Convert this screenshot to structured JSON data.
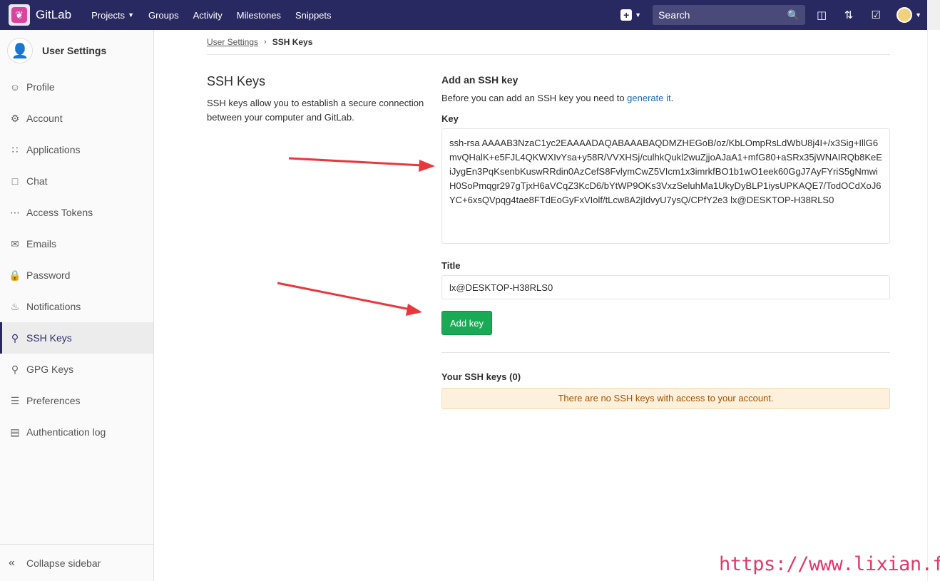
{
  "topbar": {
    "brand": "GitLab",
    "nav": [
      "Projects",
      "Groups",
      "Activity",
      "Milestones",
      "Snippets"
    ],
    "search_placeholder": "Search"
  },
  "sidebar": {
    "title": "User Settings",
    "items": [
      {
        "label": "Profile",
        "icon": "profile-icon"
      },
      {
        "label": "Account",
        "icon": "account-icon"
      },
      {
        "label": "Applications",
        "icon": "applications-icon"
      },
      {
        "label": "Chat",
        "icon": "chat-icon"
      },
      {
        "label": "Access Tokens",
        "icon": "access-tokens-icon"
      },
      {
        "label": "Emails",
        "icon": "emails-icon"
      },
      {
        "label": "Password",
        "icon": "lock-icon"
      },
      {
        "label": "Notifications",
        "icon": "bell-icon"
      },
      {
        "label": "SSH Keys",
        "icon": "key-icon"
      },
      {
        "label": "GPG Keys",
        "icon": "key-icon"
      },
      {
        "label": "Preferences",
        "icon": "sliders-icon"
      },
      {
        "label": "Authentication log",
        "icon": "log-icon"
      }
    ],
    "active_item": "SSH Keys",
    "collapse_label": "Collapse sidebar"
  },
  "breadcrumb": {
    "parent": "User Settings",
    "current": "SSH Keys"
  },
  "info": {
    "title": "SSH Keys",
    "description": "SSH keys allow you to establish a secure connection between your computer and GitLab."
  },
  "form": {
    "section_title": "Add an SSH key",
    "intro_text": "Before you can add an SSH key you need to ",
    "intro_link": "generate it",
    "intro_end": ".",
    "key_label": "Key",
    "key_value": "ssh-rsa AAAAB3NzaC1yc2EAAAADAQABAAABAQDMZHEGoB/oz/KbLOmpRsLdWbU8j4I+/x3Sig+IllG6mvQHalK+e5FJL4QKWXIvYsa+y58R/VVXHSj/culhkQukl2wuZjjoAJaA1+mfG80+aSRx35jWNAIRQb8KeEiJygEn3PqKsenbKuswRRdin0AzCefS8FvlymCwZ5VIcm1x3imrkfBO1b1wO1eek60GgJ7AyFYriS5gNmwiH0SoPmqgr297gTjxH6aVCqZ3KcD6/bYtWP9OKs3VxzSeluhMa1UkyDyBLP1iysUPKAQE7/TodOCdXoJ6YC+6xsQVpqg4tae8FTdEoGyFxVIolf/tLcw8A2jIdvyU7ysQ/CPfY2e3 lx@DESKTOP-H38RLS0",
    "title_label": "Title",
    "title_value": "lx@DESKTOP-H38RLS0",
    "submit_label": "Add key"
  },
  "keys_list": {
    "title": "Your SSH keys (0)",
    "empty_message": "There are no SSH keys with access to your account."
  },
  "watermark": "https://www.lixian.fun",
  "colors": {
    "navbar": "#292961",
    "accent_green": "#1aaa55",
    "link": "#1b69b6",
    "notice_bg": "#fdf1dd",
    "notice_text": "#a35200",
    "arrow": "#e8383d"
  }
}
